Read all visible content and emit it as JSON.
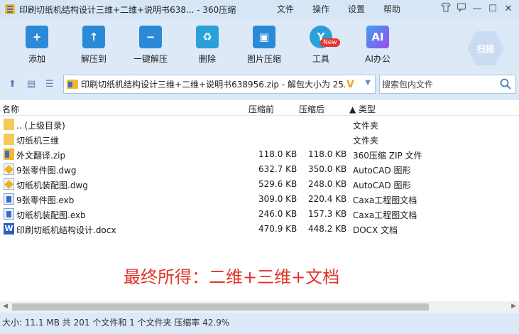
{
  "window": {
    "title": "印刷切纸机结构设计三维+二维+说明书638... - 360压缩",
    "menu": [
      "文件",
      "操作",
      "设置",
      "帮助"
    ],
    "controls": [
      "shirt-icon",
      "feedback-icon",
      "minimize-icon",
      "maximize-icon",
      "close-icon"
    ]
  },
  "toolbar": {
    "tools": [
      {
        "label": "添加",
        "icon": "add-icon",
        "color": "#2b8ad8"
      },
      {
        "label": "解压到",
        "icon": "extract-to-icon",
        "color": "#2b8ad8"
      },
      {
        "label": "一键解压",
        "icon": "one-click-extract-icon",
        "color": "#2b8ad8"
      },
      {
        "label": "删除",
        "icon": "delete-icon",
        "color": "#2aa0d8"
      },
      {
        "label": "图片压缩",
        "icon": "image-compress-icon",
        "color": "#2b8ad8"
      },
      {
        "label": "工具",
        "icon": "tools-icon",
        "color": "#2aa0d8"
      },
      {
        "label": "AI办公",
        "icon": "ai-office-icon",
        "color": "#7a5cf0"
      }
    ],
    "new_badge": "New",
    "scan_label": "扫描"
  },
  "address": {
    "path": "印刷切纸机结构设计三维+二维+说明书638956.zip - 解包大小为 25.",
    "search_placeholder": "搜索包内文件"
  },
  "columns": {
    "name": "名称",
    "packed": "压缩前",
    "compressed": "压缩后",
    "type": "▲ 类型"
  },
  "files": [
    {
      "name": ".. (上级目录)",
      "packed": "",
      "compressed": "",
      "type": "文件夹",
      "icon": "folder"
    },
    {
      "name": "切纸机三维",
      "packed": "",
      "compressed": "",
      "type": "文件夹",
      "icon": "folder"
    },
    {
      "name": "外文翻译.zip",
      "packed": "118.0 KB",
      "compressed": "118.0 KB",
      "type": "360压缩 ZIP 文件",
      "icon": "zip"
    },
    {
      "name": "9张零件图.dwg",
      "packed": "632.7 KB",
      "compressed": "350.0 KB",
      "type": "AutoCAD 图形",
      "icon": "dwg"
    },
    {
      "name": "切纸机装配图.dwg",
      "packed": "529.6 KB",
      "compressed": "248.0 KB",
      "type": "AutoCAD 图形",
      "icon": "dwg"
    },
    {
      "name": "9张零件图.exb",
      "packed": "309.0 KB",
      "compressed": "220.4 KB",
      "type": "Caxa工程图文档",
      "icon": "exb"
    },
    {
      "name": "切纸机装配图.exb",
      "packed": "246.0 KB",
      "compressed": "157.3 KB",
      "type": "Caxa工程图文档",
      "icon": "exb"
    },
    {
      "name": "印刷切纸机结构设计.docx",
      "packed": "470.9 KB",
      "compressed": "448.2 KB",
      "type": "DOCX 文档",
      "icon": "docx"
    }
  ],
  "annotation": "最终所得：二维+三维+文档",
  "status": "大小: 11.1 MB 共 201 个文件和 1 个文件夹 压缩率 42.9%"
}
